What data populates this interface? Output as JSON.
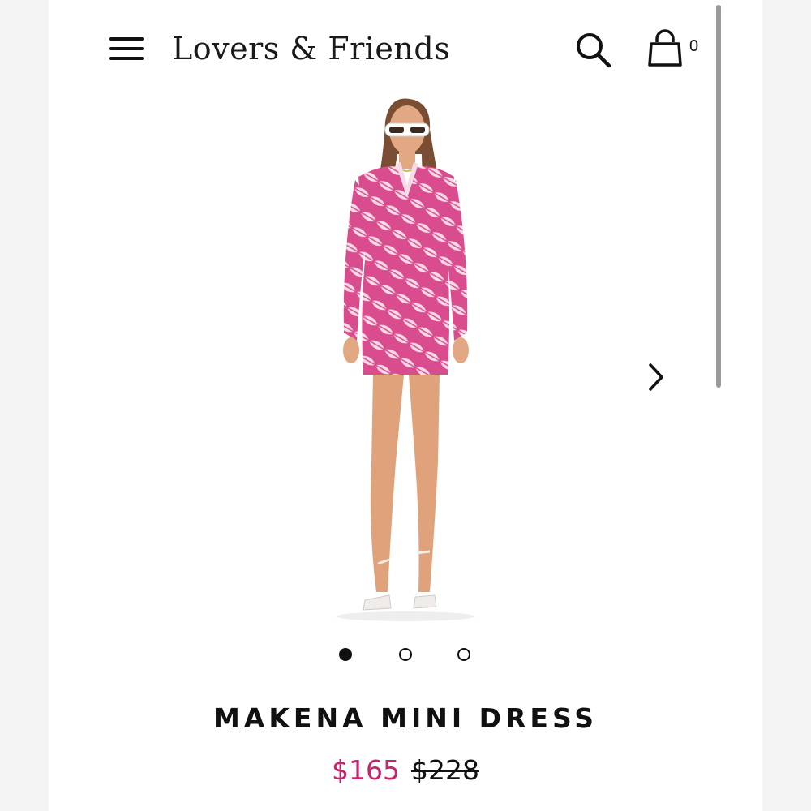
{
  "header": {
    "brand": "Lovers & Friends",
    "menu_icon": "hamburger-menu-icon",
    "search_icon": "search-icon",
    "bag_icon": "shopping-bag-icon",
    "bag_count": "0"
  },
  "gallery": {
    "image_alt": "Model wearing pink leaf print mini shirt dress",
    "next_icon": "chevron-right-icon",
    "pagination": {
      "total": 3,
      "active_index": 0
    }
  },
  "product": {
    "name": "MAKENA MINI DRESS",
    "sale_price": "$165",
    "original_price": "$228",
    "sale_color": "#c8246e"
  }
}
